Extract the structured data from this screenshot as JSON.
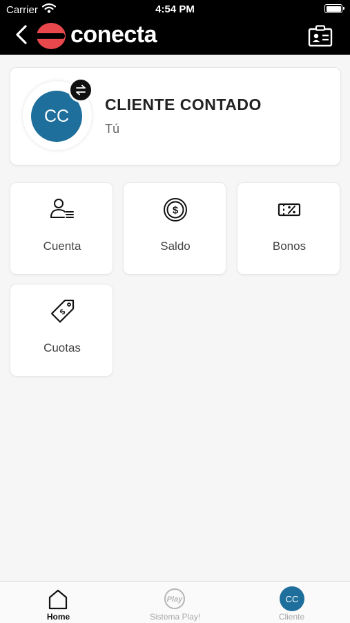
{
  "status_bar": {
    "carrier": "Carrier",
    "time": "4:54 PM"
  },
  "header": {
    "brand": "conecta"
  },
  "profile": {
    "initials": "CC",
    "name": "CLIENTE CONTADO",
    "subtitle": "Tú"
  },
  "tiles": [
    {
      "label": "Cuenta",
      "icon": "user-list-icon"
    },
    {
      "label": "Saldo",
      "icon": "dollar-coin-icon"
    },
    {
      "label": "Bonos",
      "icon": "percent-ticket-icon"
    },
    {
      "label": "Cuotas",
      "icon": "price-tag-icon"
    }
  ],
  "tabbar": [
    {
      "label": "Home",
      "icon": "home-icon",
      "active": true
    },
    {
      "label": "Sistema Play!",
      "icon": "play-logo-icon",
      "active": false
    },
    {
      "label": "Cliente",
      "icon": "client-avatar",
      "initials": "CC",
      "active": false
    }
  ],
  "colors": {
    "header_bg": "#000000",
    "brand_red": "#e8474c",
    "avatar_blue": "#1f6f9c",
    "tab_active": "#111111",
    "tab_inactive": "#a8a8a8"
  }
}
